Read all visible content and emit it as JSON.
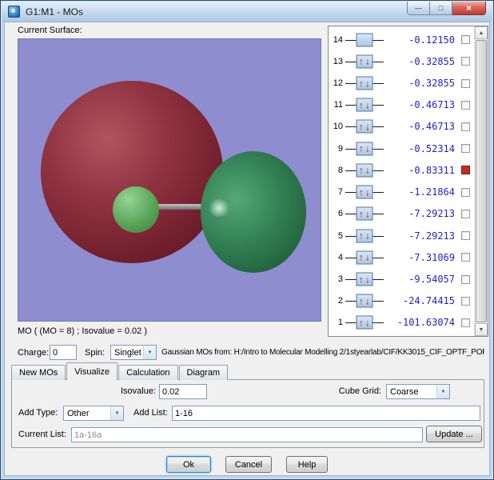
{
  "window": {
    "title": "G1:M1 - MOs"
  },
  "icons": {
    "minimize": "—",
    "maximize": "□",
    "close": "×",
    "combo_arrow": "▼",
    "scroll_up": "▲",
    "scroll_down": "▼",
    "spin_up": "↑",
    "spin_down": "↓"
  },
  "surface": {
    "label": "Current Surface:",
    "caption": "MO ( (MO = 8) ; Isovalue = 0.02 )"
  },
  "mo_list": {
    "rows": [
      {
        "num": 14,
        "energy": "-0.12150",
        "occupied": false,
        "selected": false
      },
      {
        "num": 13,
        "energy": "-0.32855",
        "occupied": true,
        "selected": false
      },
      {
        "num": 12,
        "energy": "-0.32855",
        "occupied": true,
        "selected": false
      },
      {
        "num": 11,
        "energy": "-0.46713",
        "occupied": true,
        "selected": false
      },
      {
        "num": 10,
        "energy": "-0.46713",
        "occupied": true,
        "selected": false
      },
      {
        "num": 9,
        "energy": "-0.52314",
        "occupied": true,
        "selected": false
      },
      {
        "num": 8,
        "energy": "-0.83311",
        "occupied": true,
        "selected": true
      },
      {
        "num": 7,
        "energy": "-1.21864",
        "occupied": true,
        "selected": false
      },
      {
        "num": 6,
        "energy": "-7.29213",
        "occupied": true,
        "selected": false
      },
      {
        "num": 5,
        "energy": "-7.29213",
        "occupied": true,
        "selected": false
      },
      {
        "num": 4,
        "energy": "-7.31069",
        "occupied": true,
        "selected": false
      },
      {
        "num": 3,
        "energy": "-9.54057",
        "occupied": true,
        "selected": false
      },
      {
        "num": 2,
        "energy": "-24.74415",
        "occupied": true,
        "selected": false
      },
      {
        "num": 1,
        "energy": "-101.63074",
        "occupied": true,
        "selected": false
      }
    ]
  },
  "controls": {
    "charge_label": "Charge:",
    "charge_value": "0",
    "spin_label": "Spin:",
    "spin_value": "Singlet",
    "source_text": "Gaussian MOs from:  H:/Intro to Molecular Modelling 2/1styearlab/CIF/KK3015_CIF_OPTF_POP"
  },
  "tabs": [
    {
      "label": "New MOs"
    },
    {
      "label": "Visualize"
    },
    {
      "label": "Calculation"
    },
    {
      "label": "Diagram"
    }
  ],
  "visualize": {
    "isovalue_label": "Isovalue:",
    "isovalue_value": "0.02",
    "cube_grid_label": "Cube Grid:",
    "cube_grid_value": "Coarse",
    "add_type_label": "Add Type:",
    "add_type_value": "Other",
    "add_list_label": "Add List:",
    "add_list_value": "1-16",
    "current_list_label": "Current List:",
    "current_list_value": "1a-16a",
    "update_button": "Update ..."
  },
  "footer": {
    "ok": "Ok",
    "cancel": "Cancel",
    "help": "Help"
  },
  "colors": {
    "viewport_bg": "#8d8dd0",
    "positive_lobe": "#8e3240",
    "negative_lobe": "#327f53",
    "energy_text": "#1f1fc8",
    "selected_checkbox": "#c32b2b"
  }
}
